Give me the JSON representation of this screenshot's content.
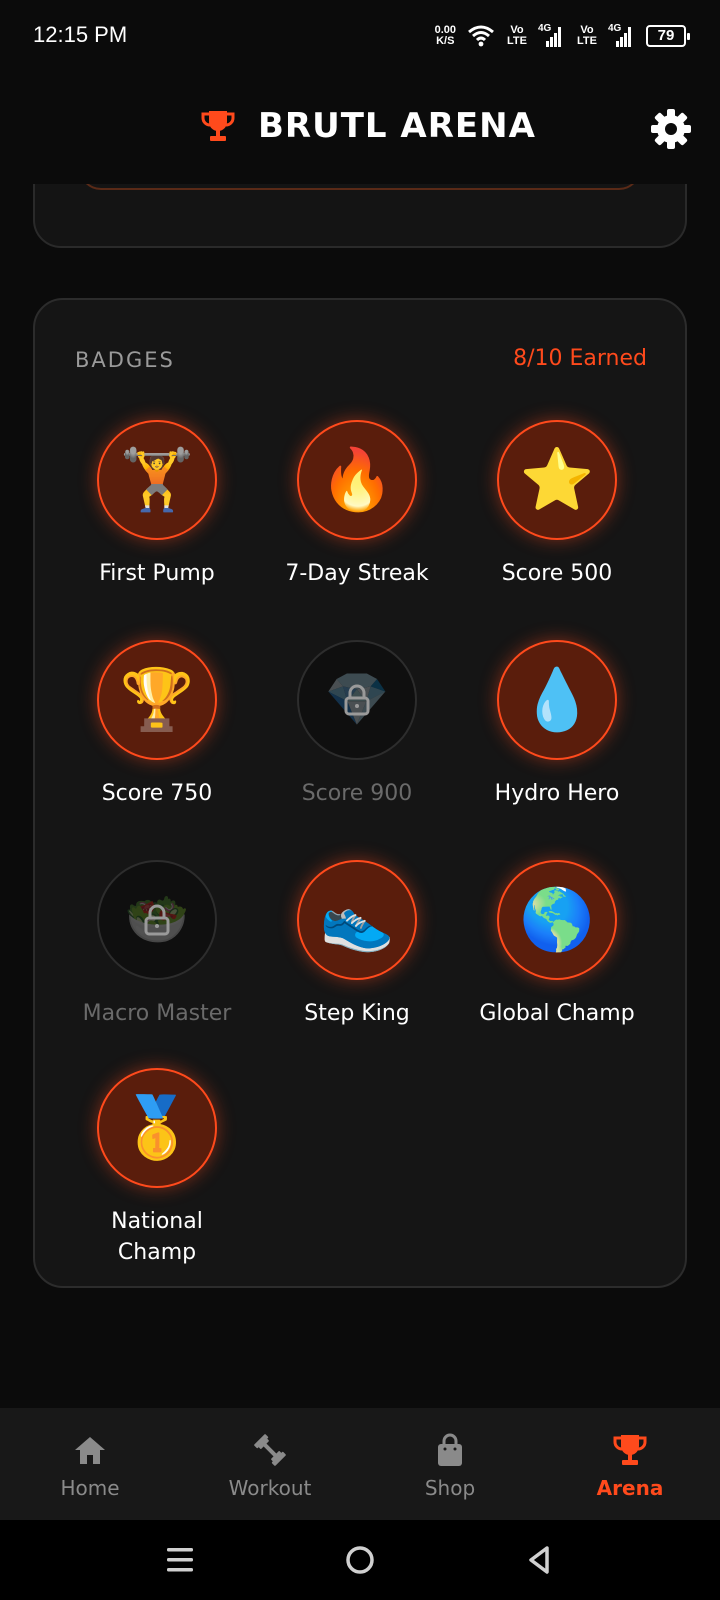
{
  "status_bar": {
    "time": "12:15 PM",
    "net_speed_value": "0.00",
    "net_speed_unit": "K/S",
    "volte_1": "Vo LTE",
    "volte_2": "Vo LTE",
    "network_1": "4G",
    "network_2": "4G",
    "battery": "79"
  },
  "header": {
    "title": "BRUTL ARENA",
    "logo_icon": "trophy-icon",
    "settings_icon": "gear-icon"
  },
  "badges": {
    "title": "BADGES",
    "earned": "8/10 Earned",
    "items": [
      {
        "name": "First Pump",
        "icon": "🏋️",
        "earned": true
      },
      {
        "name": "7-Day Streak",
        "icon": "🔥",
        "earned": true
      },
      {
        "name": "Score 500",
        "icon": "⭐",
        "earned": true
      },
      {
        "name": "Score 750",
        "icon": "🏆",
        "earned": true
      },
      {
        "name": "Score 900",
        "icon": "💎",
        "earned": false
      },
      {
        "name": "Hydro Hero",
        "icon": "💧",
        "earned": true
      },
      {
        "name": "Macro Master",
        "icon": "🥗",
        "earned": false
      },
      {
        "name": "Step King",
        "icon": "👟",
        "earned": true
      },
      {
        "name": "Global Champ",
        "icon": "🌎",
        "earned": true
      },
      {
        "name": "National Champ",
        "icon": "🥇",
        "earned": true
      }
    ]
  },
  "nav": {
    "items": [
      {
        "label": "Home",
        "icon": "home-icon"
      },
      {
        "label": "Workout",
        "icon": "dumbbell-icon"
      },
      {
        "label": "Shop",
        "icon": "shopping-bag-icon"
      },
      {
        "label": "Arena",
        "icon": "trophy-icon",
        "active": true
      }
    ]
  },
  "colors": {
    "accent": "#ff4a1c",
    "background": "#0b0b0b",
    "card": "#151515",
    "earned_fill": "#5a1d0c"
  }
}
